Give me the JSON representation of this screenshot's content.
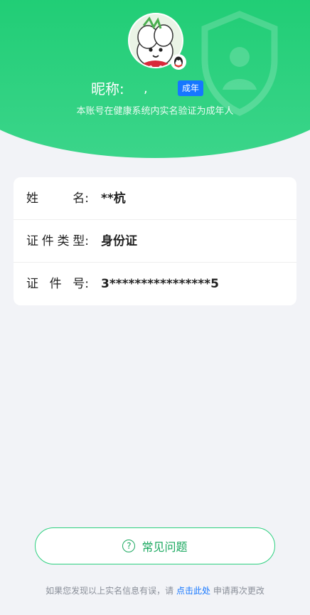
{
  "header": {
    "nickname_label": "昵称:",
    "nickname_value": ",",
    "adult_badge": "成年",
    "verify_text": "本账号在健康系统内实名验证为成年人"
  },
  "info": {
    "rows": [
      {
        "label_chars": [
          "姓",
          "名:"
        ],
        "value": "**杭"
      },
      {
        "label_chars": [
          "证",
          "件",
          "类",
          "型:"
        ],
        "value": "身份证"
      },
      {
        "label_chars": [
          "证",
          "件",
          "号:"
        ],
        "value": "3****************5"
      }
    ]
  },
  "faq": {
    "icon": "question-circle-icon",
    "label": "常见问题"
  },
  "footer": {
    "prefix": "如果您发现以上实名信息有误，请",
    "link": "点击此处",
    "suffix": "申请再次更改"
  },
  "colors": {
    "header_green": "#1ccc72",
    "badge_blue": "#1677ff",
    "faq_green": "#1aa85f"
  }
}
